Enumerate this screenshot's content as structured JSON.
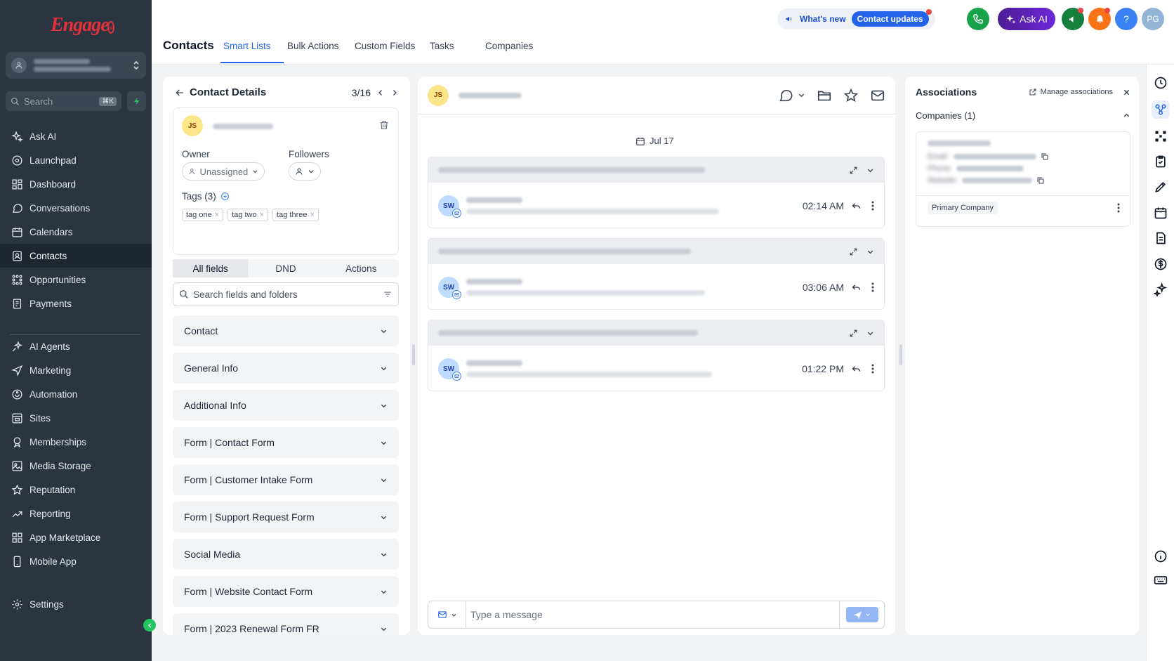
{
  "brand": {
    "logo_text": "Engage",
    "logo_mark": "ai"
  },
  "sidebar": {
    "search_placeholder": "Search",
    "search_shortcut": "⌘K",
    "items_top": [
      {
        "label": "Ask AI",
        "icon": "sparkle-icon"
      },
      {
        "label": "Launchpad",
        "icon": "launchpad-icon"
      },
      {
        "label": "Dashboard",
        "icon": "dashboard-icon"
      },
      {
        "label": "Conversations",
        "icon": "chat-icon"
      },
      {
        "label": "Calendars",
        "icon": "calendar-icon"
      },
      {
        "label": "Contacts",
        "icon": "contacts-icon",
        "active": true
      },
      {
        "label": "Opportunities",
        "icon": "opportunities-icon"
      },
      {
        "label": "Payments",
        "icon": "payments-icon"
      }
    ],
    "items_bottom": [
      {
        "label": "AI Agents",
        "icon": "ai-agents-icon"
      },
      {
        "label": "Marketing",
        "icon": "send-icon"
      },
      {
        "label": "Automation",
        "icon": "automation-icon"
      },
      {
        "label": "Sites",
        "icon": "sites-icon"
      },
      {
        "label": "Memberships",
        "icon": "memberships-icon"
      },
      {
        "label": "Media Storage",
        "icon": "media-icon"
      },
      {
        "label": "Reputation",
        "icon": "star-icon"
      },
      {
        "label": "Reporting",
        "icon": "reporting-icon"
      },
      {
        "label": "App Marketplace",
        "icon": "grid-icon"
      },
      {
        "label": "Mobile App",
        "icon": "mobile-icon"
      }
    ],
    "settings_label": "Settings"
  },
  "topbar": {
    "page_title": "Contacts",
    "tabs": [
      "Smart Lists",
      "Bulk Actions",
      "Custom Fields",
      "Tasks",
      "Companies"
    ],
    "active_tab": "Smart Lists",
    "whats_new": "What's new",
    "contact_updates": "Contact updates",
    "ask_ai": "Ask AI",
    "user_initials": "PG",
    "help": "?"
  },
  "contact_panel": {
    "title": "Contact Details",
    "pager": "3/16",
    "avatar_initials": "JS",
    "owner_label": "Owner",
    "owner_value": "Unassigned",
    "followers_label": "Followers",
    "tags_label": "Tags (3)",
    "tags": [
      "tag one",
      "tag two",
      "tag three"
    ],
    "tabs": [
      "All fields",
      "DND",
      "Actions"
    ],
    "field_search_placeholder": "Search fields and folders",
    "sections": [
      "Contact",
      "General Info",
      "Additional Info",
      "Form | Contact Form",
      "Form | Customer Intake Form",
      "Form | Support Request Form",
      "Social Media",
      "Form | Website Contact Form",
      "Form | 2023 Renewal Form FR"
    ]
  },
  "conversation": {
    "avatar_initials": "JS",
    "date": "Jul 17",
    "threads": [
      {
        "avatar": "SW",
        "time": "02:14 AM"
      },
      {
        "avatar": "SW",
        "time": "03:06 AM"
      },
      {
        "avatar": "SW",
        "time": "01:22 PM"
      }
    ],
    "composer_placeholder": "Type a message"
  },
  "associations": {
    "title": "Associations",
    "manage_label": "Manage associations",
    "companies_label": "Companies (1)",
    "card_labels": [
      "Email:",
      "Phone:",
      "Website:"
    ],
    "primary_badge": "Primary Company"
  },
  "colors": {
    "sidebar_bg": "#2b3441",
    "accent": "#2563eb",
    "brand_red": "#e3323b",
    "ask_ai_purple": "#5b21b6"
  }
}
